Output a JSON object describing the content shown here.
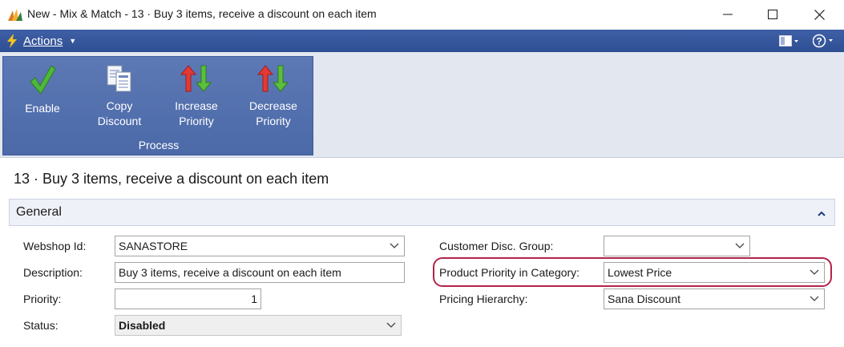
{
  "window": {
    "title": "New - Mix & Match - 13 · Buy 3 items, receive a discount on each item",
    "app_icon": "dynamics-nav-icon",
    "controls": [
      "minimize-icon",
      "maximize-icon",
      "close-icon"
    ]
  },
  "action_bar": {
    "actions_label": "Actions",
    "icons": [
      "lightning-icon",
      "layout-icon",
      "help-icon"
    ]
  },
  "ribbon": {
    "group_label": "Process",
    "buttons": [
      {
        "line1": "Enable",
        "line2": "",
        "icon": "checkmark-icon"
      },
      {
        "line1": "Copy",
        "line2": "Discount",
        "icon": "copy-document-icon"
      },
      {
        "line1": "Increase",
        "line2": "Priority",
        "icon": "increase-priority-icon"
      },
      {
        "line1": "Decrease",
        "line2": "Priority",
        "icon": "decrease-priority-icon"
      }
    ]
  },
  "page": {
    "title": "13 · Buy 3 items, receive a discount on each item"
  },
  "general": {
    "tab_title": "General",
    "fields": {
      "webshop_id": {
        "label": "Webshop Id:",
        "value": "SANASTORE"
      },
      "description": {
        "label": "Description:",
        "value": "Buy 3 items, receive a discount on each item"
      },
      "priority": {
        "label": "Priority:",
        "value": "1"
      },
      "status": {
        "label": "Status:",
        "value": "Disabled"
      },
      "customer_disc_group": {
        "label": "Customer Disc. Group:",
        "value": ""
      },
      "product_priority": {
        "label": "Product Priority in Category:",
        "value": "Lowest Price"
      },
      "pricing_hierarchy": {
        "label": "Pricing Hierarchy:",
        "value": "Sana Discount"
      }
    }
  },
  "colors": {
    "accent": "#3f5fa6",
    "ribbon_group": "#5c79b5",
    "highlight": "#b3234a"
  }
}
